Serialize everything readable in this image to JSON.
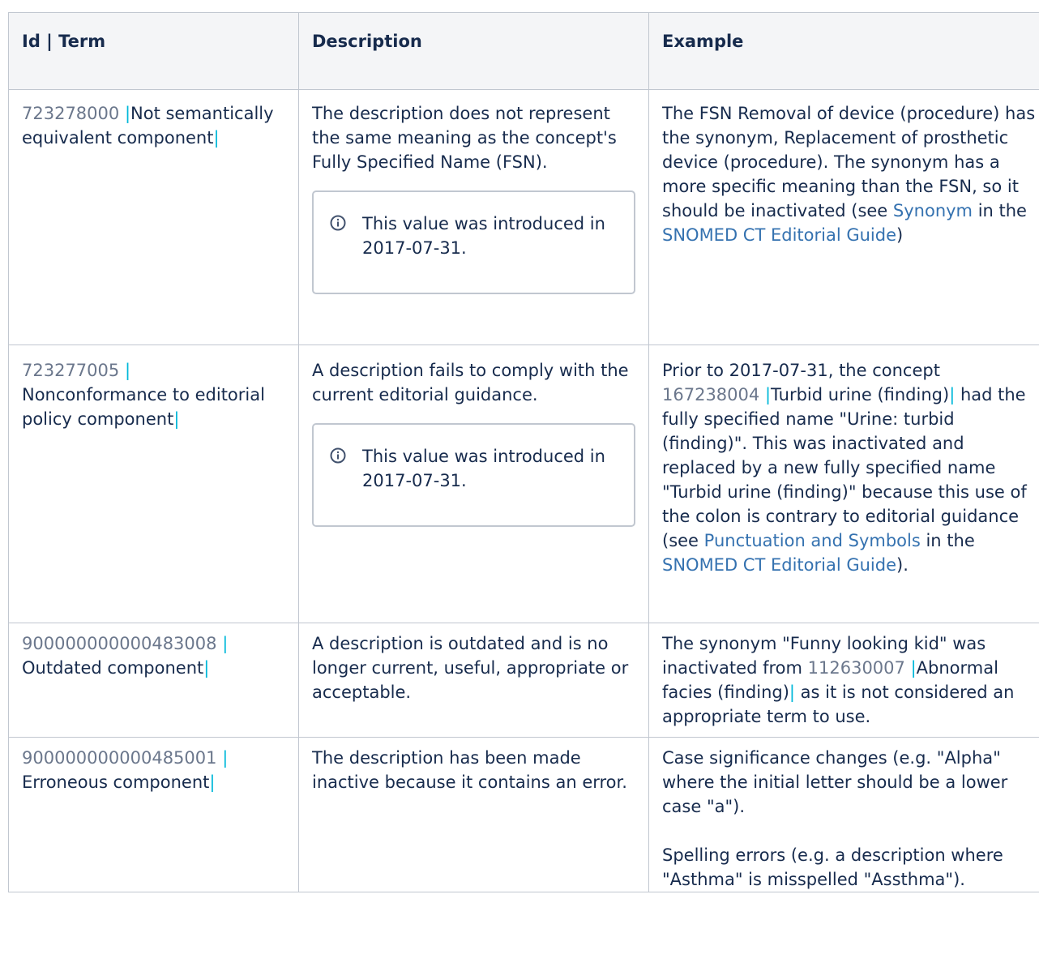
{
  "header": {
    "col1": "Id | Term",
    "col2": "Description",
    "col3": "Example"
  },
  "info_note": "This value was introduced in 2017-07-31.",
  "rows": [
    {
      "id": "723278000",
      "term": "Not semantically equivalent component",
      "description": "The description does not represent the same meaning as the concept's Fully Specified Name (FSN).",
      "example": {
        "t1": "The FSN Removal of device (procedure) has the synonym, Replacement of prosthetic device (procedure). The synonym has a more specific meaning than the FSN, so it should be inactivated (see ",
        "link1": "Synonym",
        "t2": " in the ",
        "link2": "SNOMED CT Editorial Guide",
        "t3": ")"
      }
    },
    {
      "id": "723277005",
      "term": "Nonconformance to editorial policy component",
      "description": "A description fails to comply with the current editorial guidance.",
      "example": {
        "t1": "Prior to 2017-07-31, the concept ",
        "concept_id": "167238004",
        "concept_term": "Turbid urine (finding)",
        "t2": " had the fully specified name \"Urine: turbid (finding)\". This was inactivated and replaced by a new fully specified name \"Turbid urine (finding)\" because this use of the colon is contrary to editorial guidance (see ",
        "link1": "Punctuation and Symbols",
        "t3": " in the ",
        "link2": "SNOMED CT Editorial Guide",
        "t4": ")."
      }
    },
    {
      "id": "900000000000483008",
      "term": "Outdated component",
      "description": "A description is outdated and is no longer current, useful, appropriate or acceptable.",
      "example": {
        "t1": "The synonym \"Funny looking kid\" was inactivated from ",
        "concept_id": "112630007",
        "concept_term": "Abnormal facies (finding)",
        "t2": " as it is not considered an appropriate term to use."
      }
    },
    {
      "id": "900000000000485001",
      "term": "Erroneous component",
      "description": "The description has been made inactive because it contains an error.",
      "example": {
        "p1": "Case significance changes (e.g. \"Alpha\" where the initial letter should be a lower case \"a\").",
        "p2": "Spelling errors (e.g. a description where \"Asthma\" is misspelled \"Assthma\")."
      }
    }
  ],
  "pipe": "|",
  "colors": {
    "pipe": "#00b8d9",
    "link": "#3572b0",
    "id": "#6b778c",
    "header_bg": "#f4f5f7",
    "border": "#c1c7d0"
  },
  "icons": {
    "info": "info-circle-icon"
  }
}
